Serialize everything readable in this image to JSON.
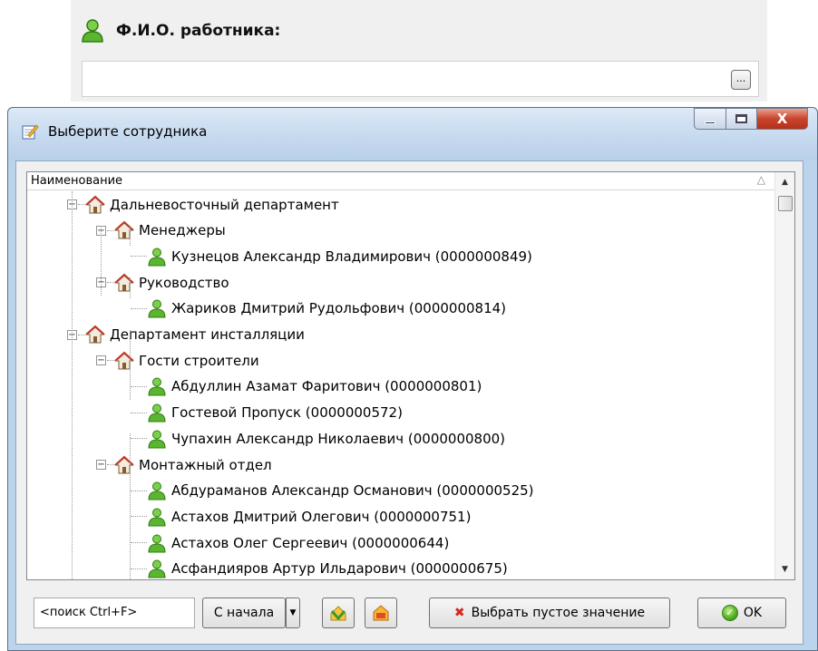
{
  "form": {
    "field_label": "Ф.И.О. работника:",
    "field_value": "",
    "ellipsis_label": "..."
  },
  "dialog": {
    "title": "Выберите сотрудника",
    "close_glyph": "X",
    "column_header": "Наименование",
    "sort_indicator": "△",
    "tree": [
      {
        "label": "Дальневосточный департамент",
        "kind": "folder",
        "level": 0
      },
      {
        "label": "Менеджеры",
        "kind": "folder",
        "level": 1
      },
      {
        "label": "Кузнецов Александр Владимирович (0000000849)",
        "kind": "person",
        "level": 2
      },
      {
        "label": "Руководство",
        "kind": "folder",
        "level": 1
      },
      {
        "label": "Жариков Дмитрий Рудольфович (0000000814)",
        "kind": "person",
        "level": 2
      },
      {
        "label": "Департамент инсталляции",
        "kind": "folder",
        "level": 0
      },
      {
        "label": "Гости строители",
        "kind": "folder",
        "level": 1
      },
      {
        "label": "Абдуллин Азамат Фаритович (0000000801)",
        "kind": "person",
        "level": 2
      },
      {
        "label": "Гостевой Пропуск (0000000572)",
        "kind": "person",
        "level": 2
      },
      {
        "label": "Чупахин Александр Николаевич (0000000800)",
        "kind": "person",
        "level": 2
      },
      {
        "label": "Монтажный отдел",
        "kind": "folder",
        "level": 1
      },
      {
        "label": "Абдураманов Александр Османович (0000000525)",
        "kind": "person",
        "level": 2
      },
      {
        "label": "Астахов Дмитрий Олегович (0000000751)",
        "kind": "person",
        "level": 2
      },
      {
        "label": "Астахов Олег Сергеевич (0000000644)",
        "kind": "person",
        "level": 2
      },
      {
        "label": "Асфандияров Артур Ильдарович (0000000675)",
        "kind": "person",
        "level": 2
      }
    ],
    "search_placeholder": "<поиск Ctrl+F>",
    "from_start_label": "С начала",
    "select_empty_label": "Выбрать пустое значение",
    "ok_label": "OK",
    "colors": {
      "title_bar": "#c4d8ee",
      "close_button": "#c8452c",
      "person_icon": "#5cb531",
      "empty_icon": "#d9251b"
    }
  }
}
